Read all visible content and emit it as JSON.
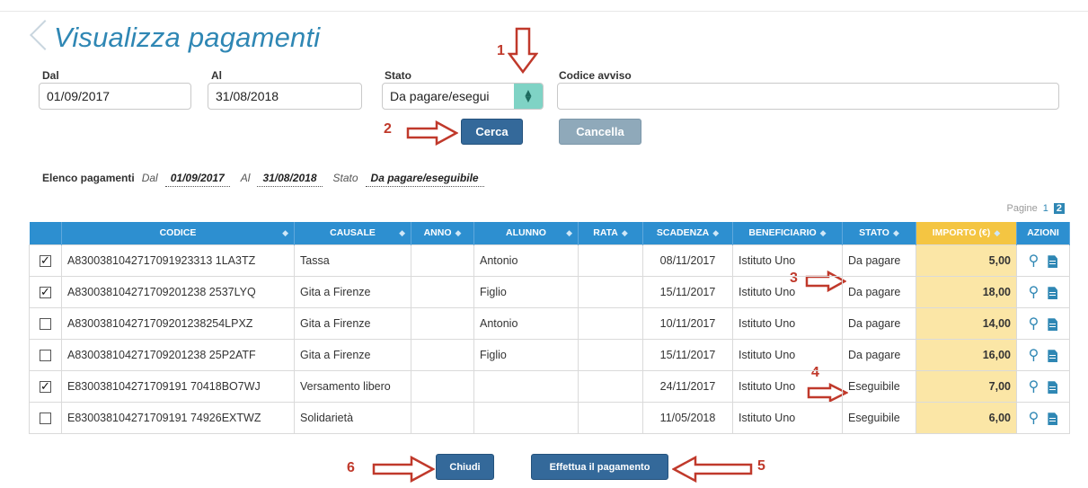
{
  "title": "Visualizza pagamenti",
  "filters": {
    "dal_label": "Dal",
    "dal_value": "01/09/2017",
    "al_label": "Al",
    "al_value": "31/08/2018",
    "stato_label": "Stato",
    "stato_value": "Da pagare/esegui",
    "codice_label": "Codice avviso",
    "codice_value": ""
  },
  "buttons": {
    "cerca": "Cerca",
    "cancella": "Cancella",
    "chiudi": "Chiudi",
    "effettua": "Effettua il pagamento"
  },
  "annotations": [
    "1",
    "2",
    "3",
    "4",
    "5",
    "6"
  ],
  "summary": {
    "label": "Elenco pagamenti",
    "dal_label": "Dal",
    "dal_value": "01/09/2017",
    "al_label": "Al",
    "al_value": "31/08/2018",
    "stato_label": "Stato",
    "stato_value": "Da pagare/eseguibile"
  },
  "pager": {
    "label": "Pagine",
    "pages": [
      "1",
      "2"
    ],
    "active": "2"
  },
  "table": {
    "headers": [
      "",
      "CODICE",
      "CAUSALE",
      "ANNO",
      "ALUNNO",
      "RATA",
      "SCADENZA",
      "BENEFICIARIO",
      "STATO",
      "IMPORTO (€)",
      "AZIONI"
    ],
    "rows": [
      {
        "checked": true,
        "codice": "A8300381042717091923313 1LA3TZ",
        "causale": "Tassa",
        "anno": "",
        "alunno": "Antonio",
        "rata": "",
        "scadenza": "08/11/2017",
        "beneficiario": "Istituto Uno",
        "stato": "Da pagare",
        "importo": "5,00"
      },
      {
        "checked": true,
        "codice": "A830038104271709201238 2537LYQ",
        "causale": "Gita a Firenze",
        "anno": "",
        "alunno": "Figlio",
        "rata": "",
        "scadenza": "15/11/2017",
        "beneficiario": "Istituto Uno",
        "stato": "Da pagare",
        "importo": "18,00"
      },
      {
        "checked": false,
        "codice": "A830038104271709201238254LPXZ",
        "causale": "Gita a Firenze",
        "anno": "",
        "alunno": "Antonio",
        "rata": "",
        "scadenza": "10/11/2017",
        "beneficiario": "Istituto Uno",
        "stato": "Da pagare",
        "importo": "14,00"
      },
      {
        "checked": false,
        "codice": "A830038104271709201238 25P2ATF",
        "causale": "Gita a Firenze",
        "anno": "",
        "alunno": "Figlio",
        "rata": "",
        "scadenza": "15/11/2017",
        "beneficiario": "Istituto Uno",
        "stato": "Da pagare",
        "importo": "16,00"
      },
      {
        "checked": true,
        "codice": "E830038104271709191 70418BO7WJ",
        "causale": "Versamento libero",
        "anno": "",
        "alunno": "",
        "rata": "",
        "scadenza": "24/11/2017",
        "beneficiario": "Istituto Uno",
        "stato": "Eseguibile",
        "importo": "7,00"
      },
      {
        "checked": false,
        "codice": "E830038104271709191 74926EXTWZ",
        "causale": "Solidarietà",
        "anno": "",
        "alunno": "",
        "rata": "",
        "scadenza": "11/05/2018",
        "beneficiario": "Istituto Uno",
        "stato": "Eseguibile",
        "importo": "6,00"
      }
    ]
  },
  "icons": {
    "search": "search-icon",
    "document": "document-icon",
    "select_arrows": "updown-arrows-icon"
  },
  "colors": {
    "title": "#2f87b4",
    "header": "#2d8fd0",
    "importo_header": "#f4c542",
    "importo_cell": "#fbe6a6",
    "primary_button": "#34699a",
    "disabled_button": "#8fa9ba",
    "annotation": "#c0392b"
  }
}
